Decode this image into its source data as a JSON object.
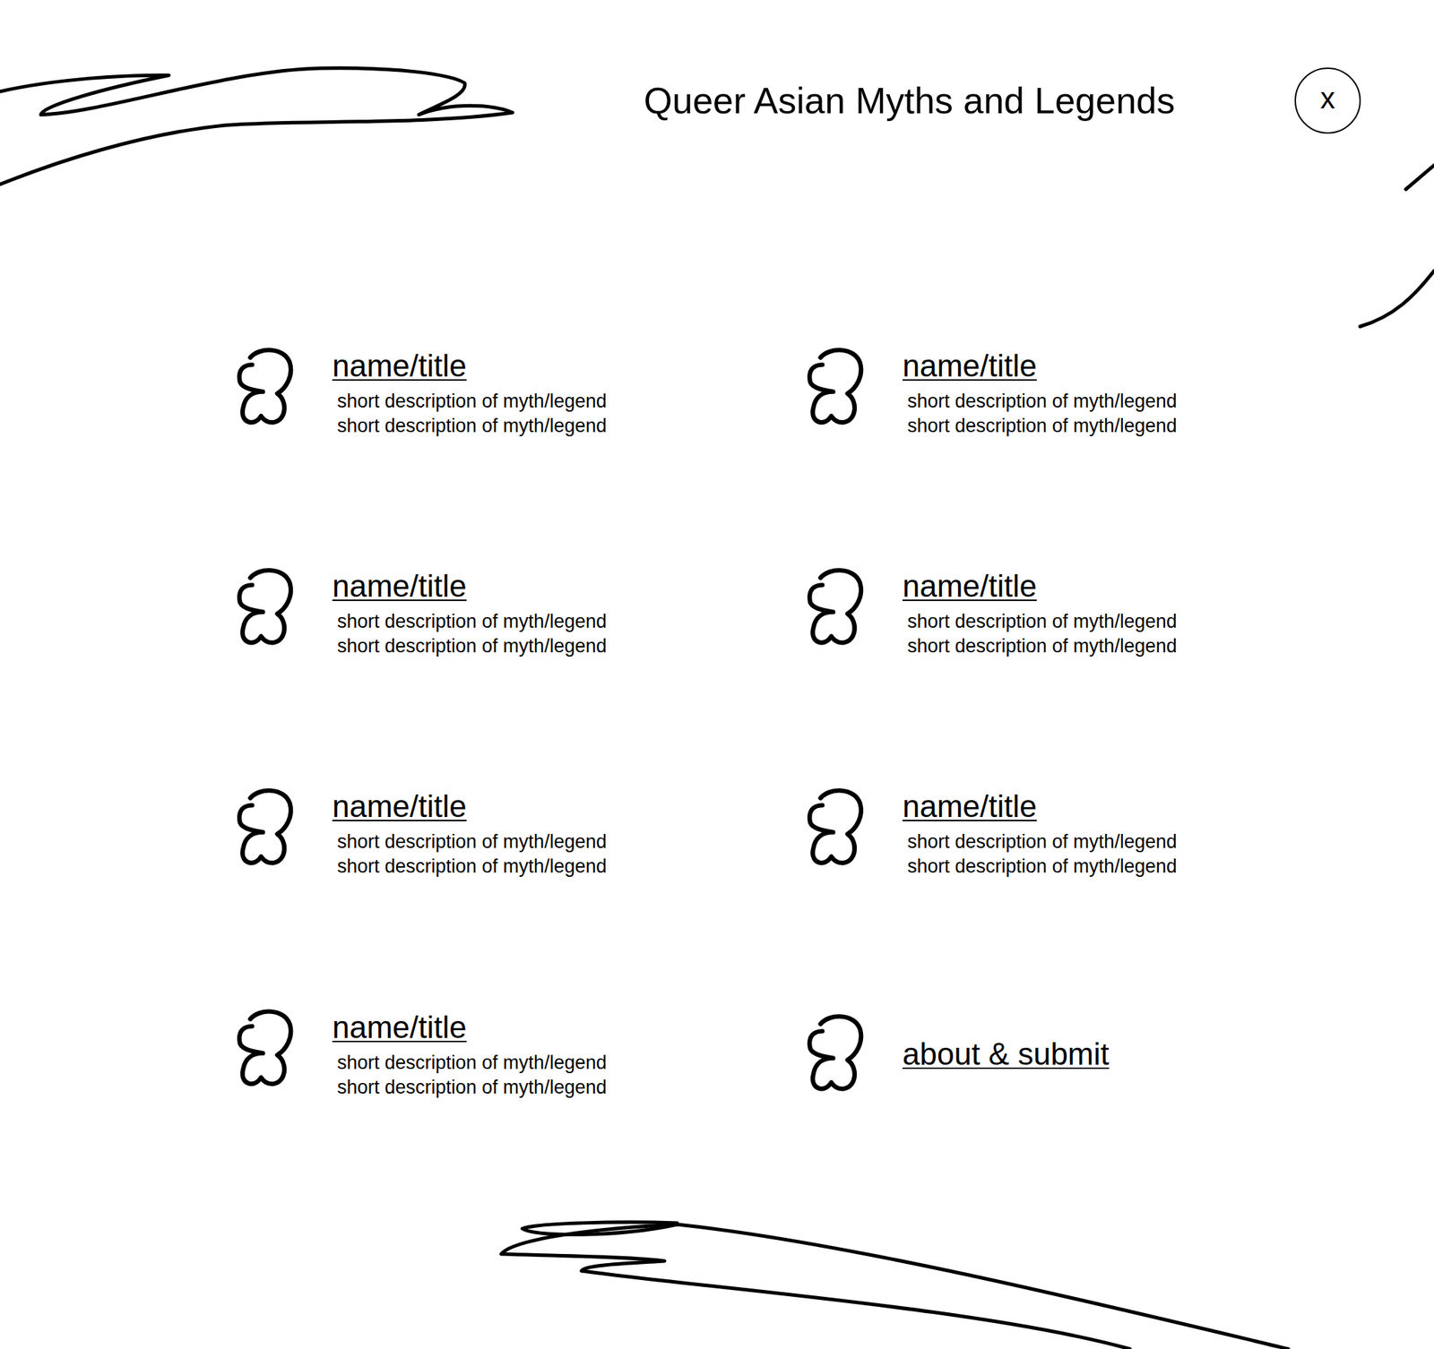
{
  "header": {
    "title": "Queer Asian Myths and Legends",
    "close_button": "x"
  },
  "items": [
    {
      "kind": "myth",
      "name": "name/title",
      "description": [
        "short description of myth/legend",
        "short description of myth/legend"
      ]
    },
    {
      "kind": "myth",
      "name": "name/title",
      "description": [
        "short description of myth/legend",
        "short description of myth/legend"
      ]
    },
    {
      "kind": "myth",
      "name": "name/title",
      "description": [
        "short description of myth/legend",
        "short description of myth/legend"
      ]
    },
    {
      "kind": "myth",
      "name": "name/title",
      "description": [
        "short description of myth/legend",
        "short description of myth/legend"
      ]
    },
    {
      "kind": "myth",
      "name": "name/title",
      "description": [
        "short description of myth/legend",
        "short description of myth/legend"
      ]
    },
    {
      "kind": "myth",
      "name": "name/title",
      "description": [
        "short description of myth/legend",
        "short description of myth/legend"
      ]
    },
    {
      "kind": "myth",
      "name": "name/title",
      "description": [
        "short description of myth/legend",
        "short description of myth/legend"
      ]
    },
    {
      "kind": "about",
      "name": "about & submit",
      "description": []
    }
  ]
}
